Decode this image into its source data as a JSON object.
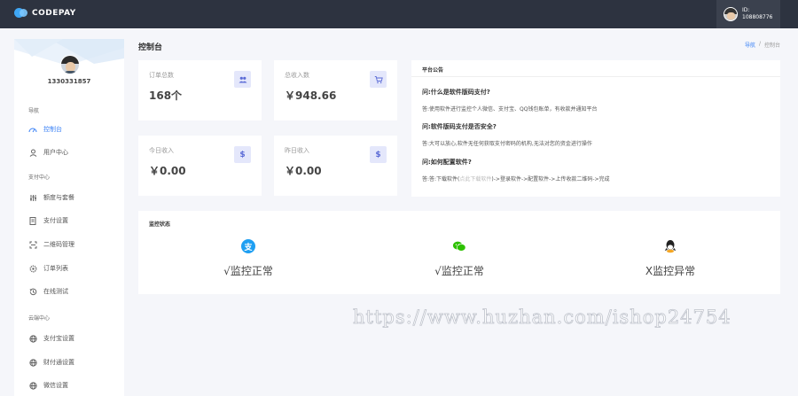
{
  "header": {
    "logo_text": "CODEPAY",
    "user_id_label": "ID:",
    "user_id": "108808776"
  },
  "sidebar": {
    "username": "1330331857",
    "sections": [
      {
        "title": "导航",
        "items": [
          {
            "label": "控制台",
            "icon": "dashboard-icon",
            "active": true
          },
          {
            "label": "用户中心",
            "icon": "user-icon"
          }
        ]
      },
      {
        "title": "支付中心",
        "items": [
          {
            "label": "额度与套餐",
            "icon": "sliders-icon"
          },
          {
            "label": "支付设置",
            "icon": "document-icon"
          },
          {
            "label": "二维码管理",
            "icon": "qrcode-icon"
          },
          {
            "label": "订单列表",
            "icon": "gear-icon"
          },
          {
            "label": "在线测试",
            "icon": "history-icon"
          }
        ]
      },
      {
        "title": "云端中心",
        "items": [
          {
            "label": "支付宝设置",
            "icon": "globe-icon"
          },
          {
            "label": "财付通设置",
            "icon": "globe-icon"
          },
          {
            "label": "微信设置",
            "icon": "globe-icon"
          }
        ]
      }
    ]
  },
  "page": {
    "title": "控制台",
    "breadcrumb": [
      "导航",
      "/",
      "控制台"
    ]
  },
  "stats": [
    {
      "label": "订单总数",
      "value": "168个",
      "icon": "users-icon"
    },
    {
      "label": "总收入数",
      "value": "￥948.66",
      "icon": "cart-icon"
    },
    {
      "label": "今日收入",
      "value": "￥0.00",
      "icon": "dollar-icon"
    },
    {
      "label": "昨日收入",
      "value": "￥0.00",
      "icon": "dollar-icon"
    }
  ],
  "notice": {
    "title": "平台公告",
    "q1": "问:什么是软件版码支付?",
    "a1": "答:使用软件进行监控个人微信、支付宝、QQ钱包账单，有收款并通知平台",
    "q2": "问:软件版码支付是否安全?",
    "a2": "答:大可以放心,软件无任何获取支付密码的机构,无法对您的资金进行操作",
    "q3": "问:如何配置软件?",
    "a3_prefix": "答:答:下载软件(",
    "a3_link": "点此下载软件",
    "a3_suffix": ")->登录软件->配置软件->上传收款二维码->完成"
  },
  "monitor": {
    "title": "监控状态",
    "items": [
      {
        "icon": "alipay-icon",
        "status": "√监控正常",
        "color": "#1e9ff2"
      },
      {
        "icon": "wechat-icon",
        "status": "√监控正常",
        "color": "#2dc100"
      },
      {
        "icon": "qq-icon",
        "status": "X监控异常",
        "color": "#222222"
      }
    ]
  },
  "watermark": "https://www.huzhan.com/ishop24754"
}
